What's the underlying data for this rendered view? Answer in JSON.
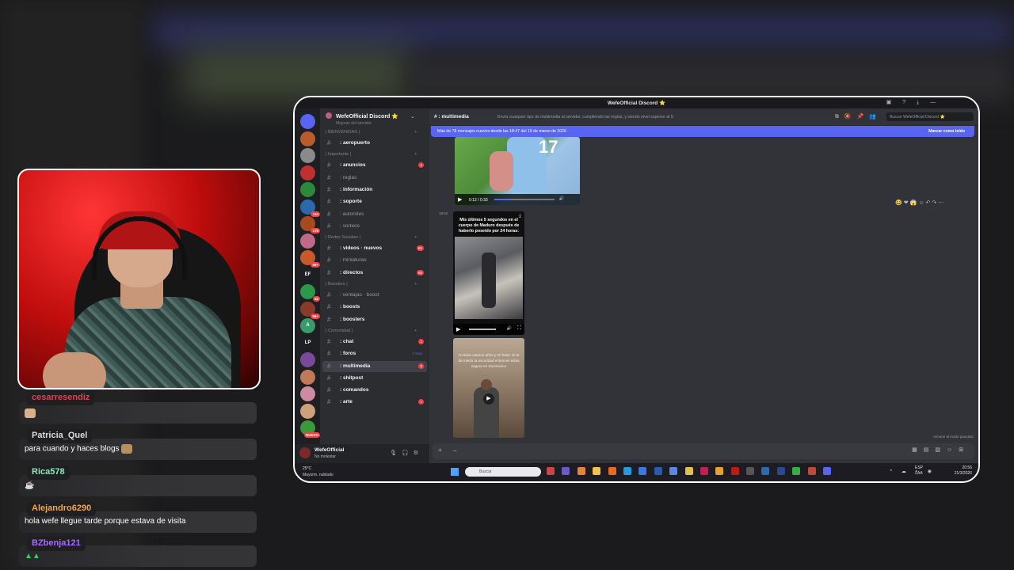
{
  "chat": {
    "messages": [
      {
        "user": "cesarresendiz",
        "color": "#e0414f",
        "text": ""
      },
      {
        "user": "Patricia_Quel",
        "color": "#dcdcdc",
        "text": "para cuando y haces blogs"
      },
      {
        "user": "Rica578",
        "color": "#8ee6b9",
        "text": ""
      },
      {
        "user": "Alejandro6290",
        "color": "#f0a64a",
        "text": "hola wefe llegue tarde porque estava de visita"
      },
      {
        "user": "BZbenja121",
        "color": "#a66cff",
        "text": ""
      }
    ]
  },
  "discord": {
    "window_title": "WefeOfficial Discord ⭐",
    "server_name": "WefeOfficial Discord ⭐",
    "server_subtitle": "Mejoras del servidor",
    "channel": {
      "name": ": multimedia",
      "topic": "Envía cualquier tipo de multimedia al servidor, cumpliendo las reglas, y siendo nivel superior al 5."
    },
    "search_placeholder": "Buscar WefeOfficial Discord ⭐",
    "new_messages": {
      "text": "Más de 78 mensajes nuevos desde las 18:47 del 19 de marzo de 2026",
      "action": "Marcar como leído"
    },
    "sidebar": {
      "categories": [
        {
          "label": "| BIENVENIDAS |",
          "channels": [
            {
              "name": ": aeropuerto",
              "bright": true
            }
          ]
        },
        {
          "label": "| Importante |",
          "channels": [
            {
              "name": ": anuncios",
              "bright": true,
              "count": "4"
            },
            {
              "name": ": reglas",
              "bright": false
            },
            {
              "name": ": información",
              "bright": true
            },
            {
              "name": ": soporte",
              "bright": true
            },
            {
              "name": ": autoroles",
              "bright": false
            },
            {
              "name": ": sorteos",
              "bright": false
            }
          ]
        },
        {
          "label": "| Redes Sociales |",
          "channels": [
            {
              "name": ": videos · nuevos",
              "bright": true,
              "count": "83"
            },
            {
              "name": ": miniaturas",
              "bright": false
            },
            {
              "name": ": directos",
              "bright": true,
              "count": "68"
            }
          ]
        },
        {
          "label": "| Boosters |",
          "channels": [
            {
              "name": ": ventajas · boost",
              "bright": false
            },
            {
              "name": ": boosts",
              "bright": true
            },
            {
              "name": ": boosters",
              "bright": true
            }
          ]
        },
        {
          "label": "| Comunidad |",
          "channels": [
            {
              "name": ": chat",
              "bright": true,
              "count": "1"
            },
            {
              "name": ": foros",
              "bright": true,
              "count": "1 New",
              "blue": true
            },
            {
              "name": ": multimedia",
              "bright": true,
              "count": "3",
              "active": true
            },
            {
              "name": ": shitpost",
              "bright": true
            },
            {
              "name": ": comandos",
              "bright": true
            },
            {
              "name": ": arte",
              "bright": true,
              "count": "1"
            }
          ]
        }
      ]
    },
    "servers": [
      {
        "label": "",
        "color": "#5865f2",
        "badge": ""
      },
      {
        "label": "",
        "color": "#b85c2c",
        "badge": ""
      },
      {
        "label": "",
        "color": "#8a8a8a",
        "badge": ""
      },
      {
        "label": "",
        "color": "#c03030",
        "badge": ""
      },
      {
        "label": "",
        "color": "#2a8a3a",
        "badge": ""
      },
      {
        "label": "",
        "color": "#2a6aaa",
        "badge": "154"
      },
      {
        "label": "",
        "color": "#a84a20",
        "badge": "176"
      },
      {
        "label": "",
        "color": "#c06a8a",
        "badge": ""
      },
      {
        "label": "",
        "color": "#c85a2a",
        "badge": "96+"
      },
      {
        "label": "EF",
        "color": "#1e1f22",
        "badge": ""
      },
      {
        "label": "",
        "color": "#2a9a4a",
        "badge": "52"
      },
      {
        "label": "",
        "color": "#8a3a2a",
        "badge": "96+"
      },
      {
        "label": "A",
        "color": "#3a9a6a",
        "badge": ""
      },
      {
        "label": "LP",
        "color": "#1e1f22",
        "badge": ""
      },
      {
        "label": "",
        "color": "#7a4a9a",
        "badge": ""
      },
      {
        "label": "",
        "color": "#c07a5a",
        "badge": ""
      },
      {
        "label": "",
        "color": "#d08aa0",
        "badge": ""
      },
      {
        "label": "",
        "color": "#d0a07a",
        "badge": ""
      },
      {
        "label": "",
        "color": "#3a9a3a",
        "badge": "NUEVO"
      }
    ],
    "messages": {
      "video1": {
        "time": "0:12 / 0:33",
        "overlay_number": "17"
      },
      "timestamp2": "18:52",
      "video2": {
        "caption": "Mis últimos 5 segundos en el cuerpo de Maduro después de haberlo poseído por 24 horas:"
      },
      "video3": {
        "caption": "Yo tiene catorce años y mi frase: Si te da miedo la oscuridad entonces estas segura en Soconusco"
      }
    },
    "slow_mode": "Inmune al modo pausado",
    "user": {
      "name": "WefeOfficial",
      "status": "No molestar"
    }
  },
  "taskbar": {
    "weather_temp": "25°C",
    "weather_desc": "Mayorm. nublado",
    "search_placeholder": "Buscar",
    "lang": "ESP",
    "lang2": "LAA",
    "time": "20:56",
    "date": "21/3/2026"
  },
  "colors": {
    "accent": "#5865f2",
    "mention": "#f23f43",
    "webcam_border": "#ffffff"
  }
}
